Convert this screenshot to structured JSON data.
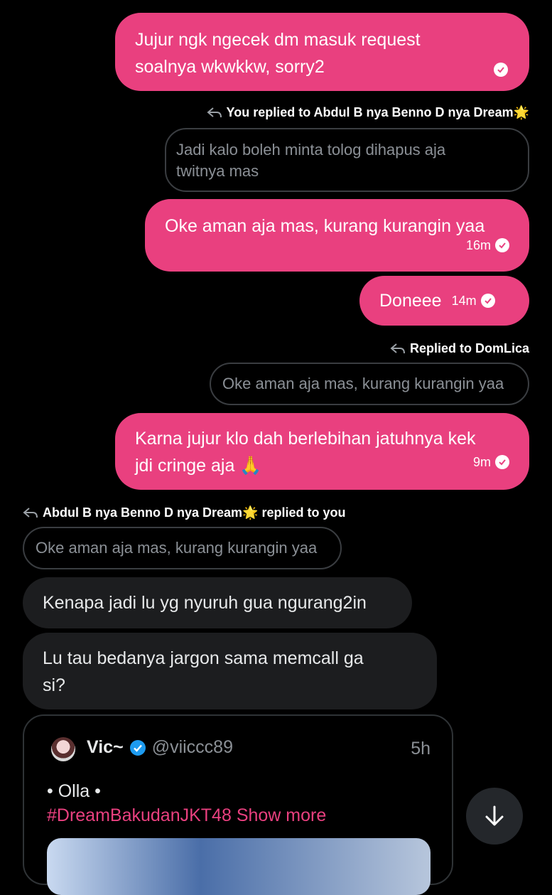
{
  "messages": {
    "m1": {
      "text_line1": "Jujur ngk ngecek dm masuk request",
      "text_line2": "soalnya wkwkkw, sorry2"
    },
    "reply1": {
      "label": "You replied to Abdul B nya Benno D nya Dream🌟",
      "quote_line1": "Jadi kalo boleh minta tolog dihapus aja",
      "quote_line2": "twitnya mas"
    },
    "m2": {
      "text": "Oke aman aja mas, kurang kurangin yaa",
      "time": "16m"
    },
    "m3": {
      "text": "Doneee",
      "time": "14m"
    },
    "reply2": {
      "label": "Replied to DomLica",
      "quote": "Oke aman aja mas, kurang kurangin yaa"
    },
    "m4": {
      "text_line1": "Karna jujur klo dah berlebihan jatuhnya kek",
      "text_line2": "jdi cringe aja 🙏",
      "time": "9m"
    },
    "reply3": {
      "label": "Abdul B nya Benno D nya Dream🌟 replied to you",
      "quote": "Oke aman aja mas, kurang kurangin yaa"
    },
    "in1": {
      "text": "Kenapa jadi lu yg nyuruh gua ngurang2in"
    },
    "in2": {
      "text_line1": "Lu tau bedanya jargon sama memcall ga",
      "text_line2": "si?"
    }
  },
  "tweet": {
    "name": "Vic~",
    "handle": "@viiccc89",
    "age": "5h",
    "body_line1": "• Olla •",
    "hashtag": "#DreamBakudanJKT48",
    "show_more": "Show more"
  },
  "colors": {
    "accent": "#e9407f",
    "incoming": "#1c1d1f",
    "verified": "#1d9bf0"
  },
  "icons": {
    "reply": "reply-arrow-icon",
    "read": "read-check-icon",
    "scroll": "arrow-down-icon",
    "verified": "verified-badge-icon"
  }
}
